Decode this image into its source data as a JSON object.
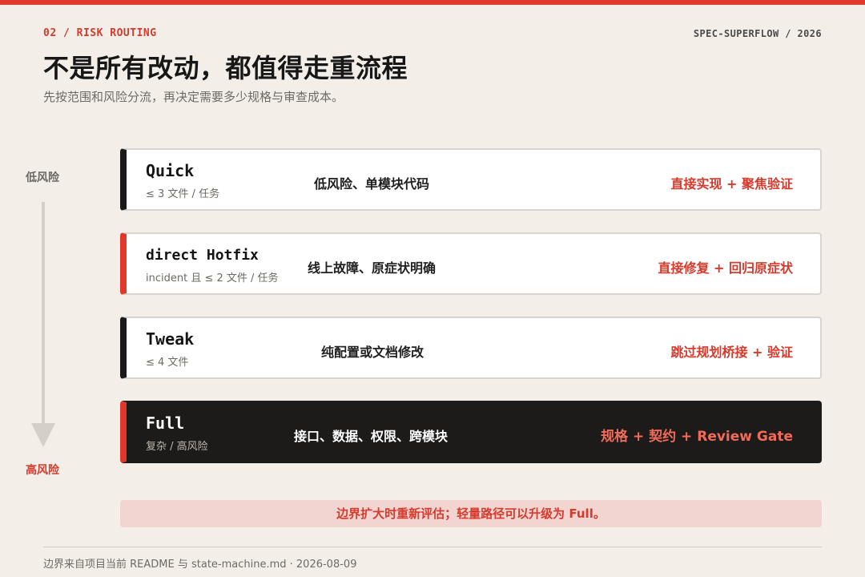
{
  "header": {
    "kicker": "02 / RISK ROUTING",
    "brand": "SPEC-SUPERFLOW / 2026",
    "title": "不是所有改动，都值得走重流程",
    "subtitle": "先按范围和风险分流，再决定需要多少规格与审查成本。"
  },
  "axis": {
    "low_label": "低风险",
    "high_label": "高风险"
  },
  "routes": [
    {
      "name": "Quick",
      "scope": "≤ 3 文件 / 任务",
      "desc": "低风险、单模块代码",
      "action": "直接实现 + 聚焦验证"
    },
    {
      "name": "direct Hotfix",
      "scope": "incident 且 ≤ 2 文件 / 任务",
      "desc": "线上故障、原症状明确",
      "action": "直接修复 + 回归原症状"
    },
    {
      "name": "Tweak",
      "scope": "≤ 4 文件",
      "desc": "纯配置或文档修改",
      "action": "跳过规划桥接 + 验证"
    },
    {
      "name": "Full",
      "scope": "复杂 / 高风险",
      "desc": "接口、数据、权限、跨模块",
      "action": "规格 + 契约 + Review Gate"
    }
  ],
  "note": "边界扩大时重新评估；轻量路径可以升级为 Full。",
  "footer": "边界来自项目当前 README 与 state-machine.md · 2026-08-09",
  "colors": {
    "accent": "#e0392b",
    "background": "#f3efe8",
    "dark_card": "#1d1b1a"
  }
}
